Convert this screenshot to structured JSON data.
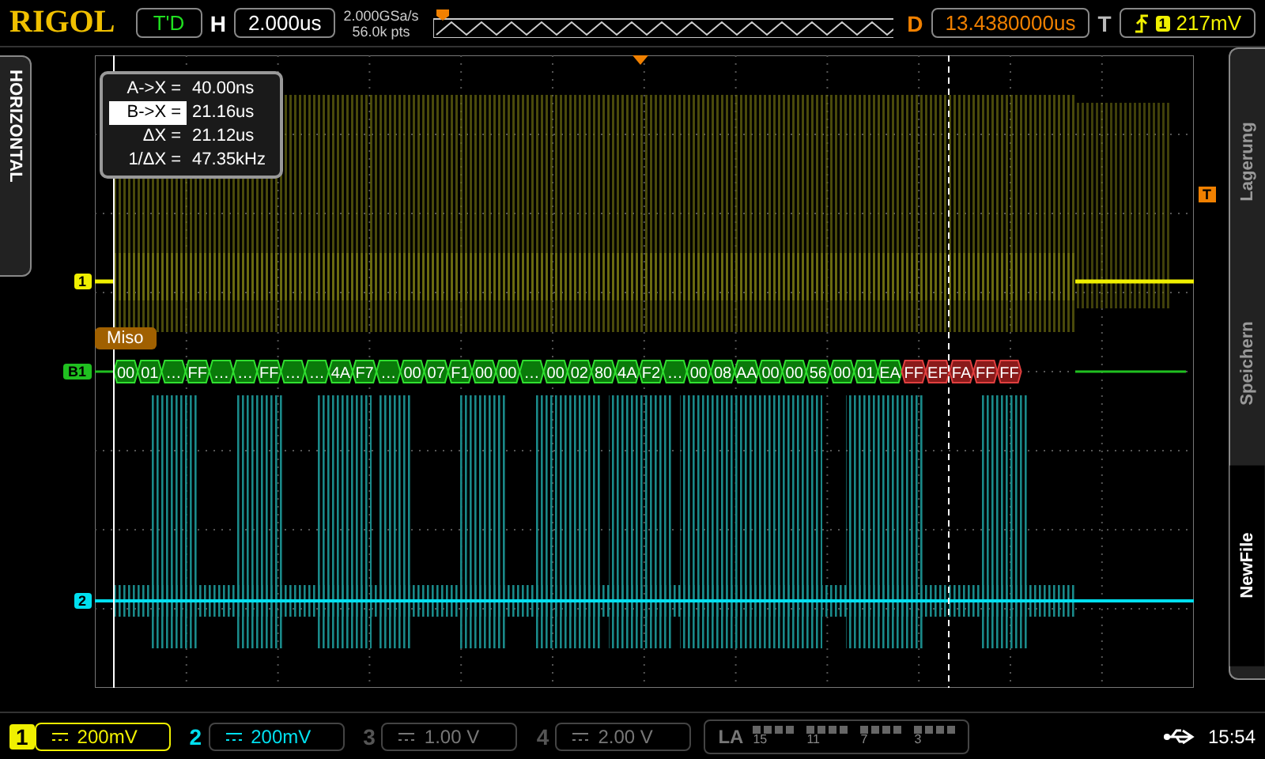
{
  "header": {
    "brand": "RIGOL",
    "run_state": "T'D",
    "timebase_label": "H",
    "timebase": "2.000us",
    "sample_rate": "2.000GSa/s",
    "memory_depth": "56.0k pts",
    "delay_label": "D",
    "delay": "13.4380000us",
    "trigger_label": "T",
    "trigger_source": "1",
    "trigger_level": "217mV"
  },
  "side_tab": "HORIZONTAL",
  "cursor_readout": [
    {
      "label": "A->X =",
      "value": "40.00ns",
      "selected": false
    },
    {
      "label": "B->X =",
      "value": "21.16us",
      "selected": true
    },
    {
      "label": "ΔX =",
      "value": "21.12us",
      "selected": false
    },
    {
      "label": "1/ΔX =",
      "value": "47.35kHz",
      "selected": false
    }
  ],
  "decoder": {
    "label": "Miso",
    "bus": "B1",
    "packets": [
      {
        "text": "00",
        "error": false
      },
      {
        "text": "01",
        "error": false
      },
      {
        "text": "…",
        "error": false
      },
      {
        "text": "FF",
        "error": false
      },
      {
        "text": "…",
        "error": false
      },
      {
        "text": "…",
        "error": false
      },
      {
        "text": "FF",
        "error": false
      },
      {
        "text": "…",
        "error": false
      },
      {
        "text": "…",
        "error": false
      },
      {
        "text": "4A",
        "error": false
      },
      {
        "text": "F7",
        "error": false
      },
      {
        "text": "…",
        "error": false
      },
      {
        "text": "00",
        "error": false
      },
      {
        "text": "07",
        "error": false
      },
      {
        "text": "F1",
        "error": false
      },
      {
        "text": "00",
        "error": false
      },
      {
        "text": "00",
        "error": false
      },
      {
        "text": "…",
        "error": false
      },
      {
        "text": "00",
        "error": false
      },
      {
        "text": "02",
        "error": false
      },
      {
        "text": "80",
        "error": false
      },
      {
        "text": "4A",
        "error": false
      },
      {
        "text": "F2",
        "error": false
      },
      {
        "text": "…",
        "error": false
      },
      {
        "text": "00",
        "error": false
      },
      {
        "text": "08",
        "error": false
      },
      {
        "text": "AA",
        "error": false
      },
      {
        "text": "00",
        "error": false
      },
      {
        "text": "00",
        "error": false
      },
      {
        "text": "56",
        "error": false
      },
      {
        "text": "00",
        "error": false
      },
      {
        "text": "01",
        "error": false
      },
      {
        "text": "EA",
        "error": false
      },
      {
        "text": "FF",
        "error": true
      },
      {
        "text": "EF",
        "error": true
      },
      {
        "text": "FA",
        "error": true
      },
      {
        "text": "FF",
        "error": true
      },
      {
        "text": "FF",
        "error": true
      }
    ]
  },
  "channel_markers": [
    {
      "text": "1",
      "color": "#f0f000"
    },
    {
      "text": "2",
      "color": "#00e0f0"
    }
  ],
  "trigger_marker": "T",
  "menu": [
    {
      "label": "Lagerung",
      "selected": false
    },
    {
      "label": "Speichern",
      "selected": false
    },
    {
      "label": "NewFile",
      "selected": true
    }
  ],
  "channels": [
    {
      "number": "1",
      "scale": "200mV",
      "enabled": true,
      "selected": true,
      "color": "#f0f000"
    },
    {
      "number": "2",
      "scale": "200mV",
      "enabled": true,
      "selected": false,
      "color": "#00e0f0"
    },
    {
      "number": "3",
      "scale": "1.00 V",
      "enabled": false,
      "selected": false
    },
    {
      "number": "4",
      "scale": "2.00 V",
      "enabled": false,
      "selected": false
    }
  ],
  "la": {
    "label": "LA",
    "bits": [
      "15",
      "11",
      "7",
      "3"
    ]
  },
  "status": {
    "time": "15:54"
  }
}
